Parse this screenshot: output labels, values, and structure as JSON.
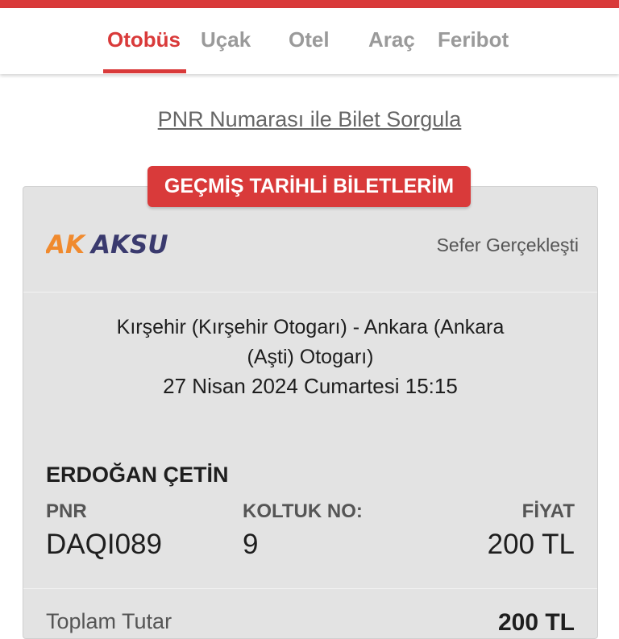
{
  "tabs": [
    {
      "label": "Otobüs",
      "active": true
    },
    {
      "label": "Uçak"
    },
    {
      "label": "Otel"
    },
    {
      "label": "Araç"
    },
    {
      "label": "Feribot"
    }
  ],
  "pnr_query_link": "PNR Numarası ile Bilet Sorgula",
  "history_button": "GEÇMİŞ TARİHLİ BİLETLERİM",
  "ticket": {
    "company_logo": {
      "part1": "AK",
      "part2": "AKSU"
    },
    "status": "Sefer Gerçekleşti",
    "route_line1": "Kırşehir (Kırşehir Otogarı) - Ankara (Ankara",
    "route_line2": "(Aşti) Otogarı)",
    "datetime": "27 Nisan 2024 Cumartesi 15:15",
    "passenger": "ERDOĞAN ÇETİN",
    "pnr_label": "PNR",
    "pnr_value": "DAQI089",
    "seat_label": "KOLTUK NO:",
    "seat_value": "9",
    "price_label": "FİYAT",
    "price_value": "200 TL",
    "total_label": "Toplam Tutar",
    "total_value": "200 TL"
  },
  "colors": {
    "accent": "#d93a3a",
    "logo_orange": "#f08a2e",
    "logo_navy": "#3a3a6e",
    "card_bg": "#e3e3e3"
  }
}
